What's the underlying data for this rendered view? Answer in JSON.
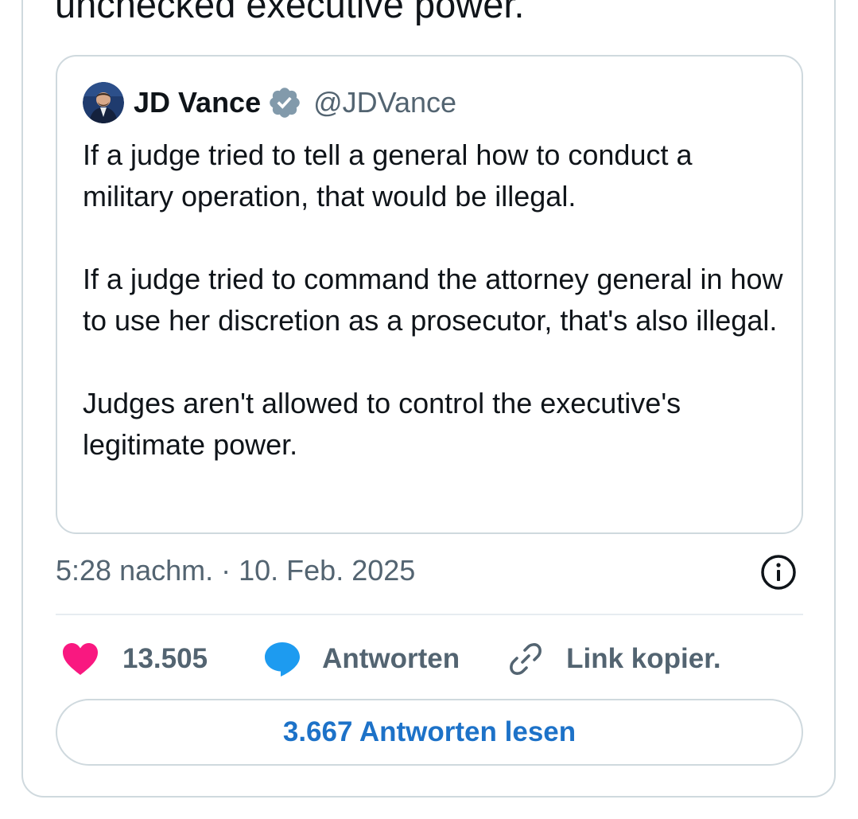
{
  "tweet": {
    "text_visible": "unchecked executive power."
  },
  "quoted_tweet": {
    "author_name": "JD Vance",
    "author_handle": "@JDVance",
    "verified_icon": "verified-badge-icon",
    "paragraphs": [
      "If a judge tried to tell a general how to conduct a military operation, that would be illegal.",
      "If a judge tried to command the attorney general in how to use her discretion as a prosecutor, that's also illegal.",
      "Judges aren't allowed to control the executive's legitimate power."
    ]
  },
  "meta": {
    "timestamp": "5:28 nachm. · 10. Feb. 2025",
    "info_icon": "info-icon"
  },
  "actions": {
    "like_count": "13.505",
    "like_icon": "heart-icon",
    "reply_label": "Antworten",
    "reply_icon": "speech-bubble-icon",
    "link_label": "Link kopier.",
    "link_icon": "link-icon"
  },
  "read_replies": {
    "label": "3.667 Antworten lesen"
  },
  "colors": {
    "like": "#f91880",
    "reply": "#1d9bf0",
    "link_button_text": "#1d72c8",
    "muted": "#536471",
    "border": "#cfd9de"
  }
}
